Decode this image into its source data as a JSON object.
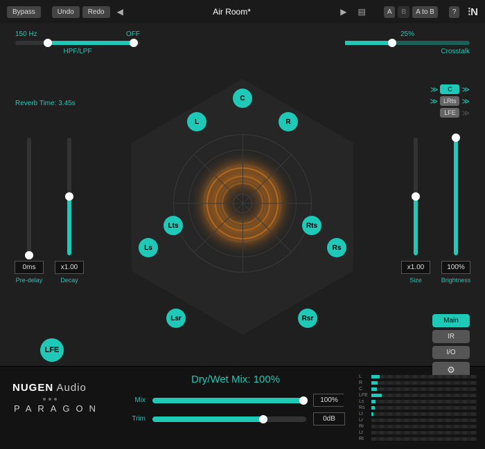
{
  "toolbar": {
    "bypass": "Bypass",
    "undo": "Undo",
    "redo": "Redo",
    "preset_name": "Air Room*",
    "a": "A",
    "b": "B",
    "atob": "A to B",
    "help": "?"
  },
  "hpf": {
    "low": "150 Hz",
    "high": "OFF",
    "label": "HPF/LPF",
    "low_pct": 26,
    "high_pct": 95
  },
  "crosstalk": {
    "value": "25%",
    "label": "Crosstalk",
    "pct": 38
  },
  "routing": [
    {
      "label": "C",
      "style": "teal",
      "in": true,
      "out": true
    },
    {
      "label": "LRts",
      "style": "gray",
      "in": true,
      "out": true
    },
    {
      "label": "LFE",
      "style": "gray",
      "in": false,
      "out": true
    }
  ],
  "reverb_time": "Reverb Time: 3.45s",
  "sliders": {
    "predelay": {
      "label": "Pre-delay",
      "value": "0ms",
      "pct": 0
    },
    "decay": {
      "label": "Decay",
      "value": "x1.00",
      "pct": 50
    },
    "size": {
      "label": "Size",
      "value": "x1.00",
      "pct": 50
    },
    "brightness": {
      "label": "Brightness",
      "value": "100%",
      "pct": 100
    }
  },
  "channels": {
    "C": "C",
    "L": "L",
    "R": "R",
    "Lts": "Lts",
    "Rts": "Rts",
    "Ls": "Ls",
    "Rs": "Rs",
    "Lsr": "Lsr",
    "Rsr": "Rsr",
    "LFE": "LFE"
  },
  "right_tabs": {
    "main": "Main",
    "ir": "IR",
    "io": "I/O"
  },
  "drywet": {
    "title": "Dry/Wet Mix: 100%",
    "mix": {
      "label": "Mix",
      "value": "100%",
      "pct": 100
    },
    "trim": {
      "label": "Trim",
      "value": "0dB",
      "pct": 72
    }
  },
  "brand": {
    "top": "NUGEN Audio",
    "bottom": "PARAGON"
  },
  "meters": [
    {
      "l": "L",
      "v": 8
    },
    {
      "l": "R",
      "v": 6
    },
    {
      "l": "C",
      "v": 5
    },
    {
      "l": "LFE",
      "v": 10
    },
    {
      "l": "Ls",
      "v": 4
    },
    {
      "l": "Rs",
      "v": 3
    },
    {
      "l": "Lt",
      "v": 2
    },
    {
      "l": "Lr",
      "v": 0
    },
    {
      "l": "Rr",
      "v": 0
    },
    {
      "l": "Lt",
      "v": 0
    },
    {
      "l": "Rt",
      "v": 0
    }
  ]
}
